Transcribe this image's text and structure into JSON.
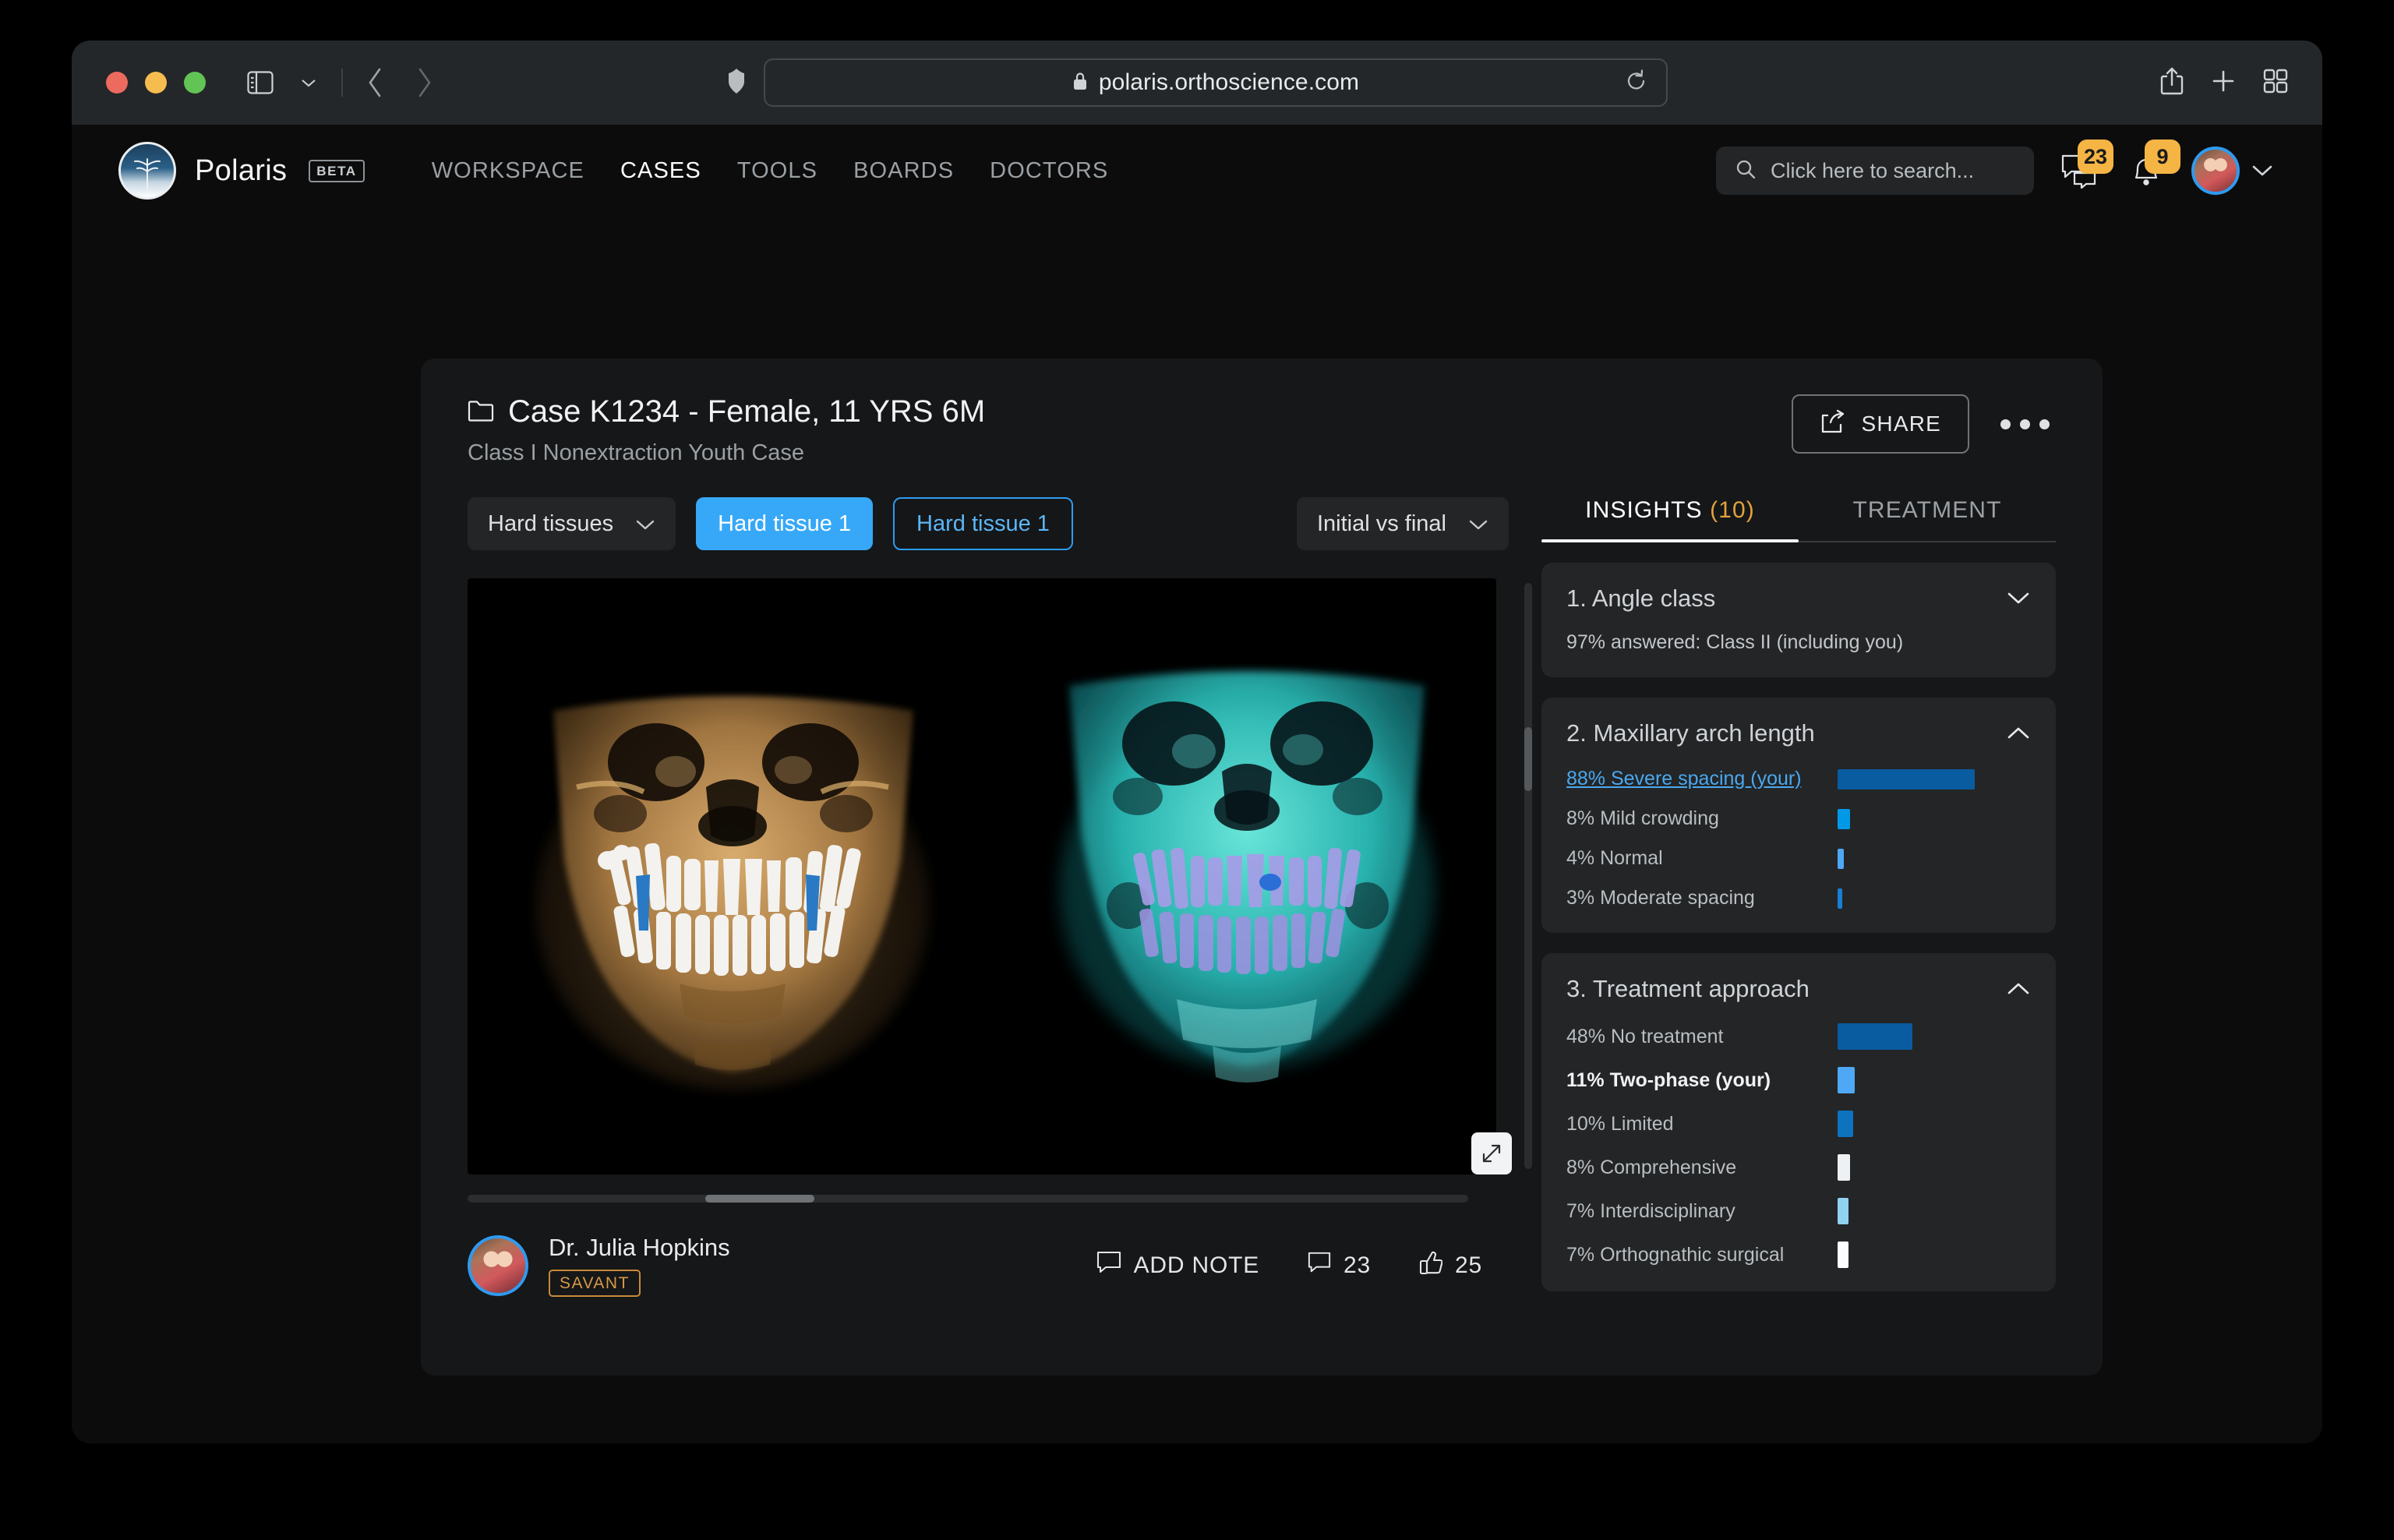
{
  "browser": {
    "url": "polaris.orthoscience.com",
    "lock_icon": "lock-icon",
    "shield_icon": "privacy-shield-icon",
    "reload_icon": "reload-icon",
    "sidebar_icon": "sidebar-toggle-icon",
    "back_icon": "back-arrow-icon",
    "forward_icon": "forward-arrow-icon",
    "share_icon": "share-icon",
    "new_tab_icon": "plus-icon",
    "tab_overview_icon": "tab-grid-icon"
  },
  "appbar": {
    "brand": "Polaris",
    "beta": "BETA",
    "logo_icon": "polaris-tree-logo",
    "nav": [
      {
        "label": "WORKSPACE",
        "active": false
      },
      {
        "label": "CASES",
        "active": true
      },
      {
        "label": "TOOLS",
        "active": false
      },
      {
        "label": "BOARDS",
        "active": false
      },
      {
        "label": "DOCTORS",
        "active": false
      }
    ],
    "search": {
      "placeholder": "Click here to search...",
      "icon": "search-icon",
      "value": ""
    },
    "messages": {
      "icon": "chat-bubble-icon",
      "count": "23"
    },
    "notifications": {
      "icon": "bell-icon",
      "count": "9"
    },
    "account": {
      "avatar_icon": "user-avatar",
      "chevron_icon": "chevron-down-icon"
    }
  },
  "case": {
    "folder_icon": "folder-icon",
    "title": "Case K1234 - Female, 11 YRS 6M",
    "subtitle": "Class I Nonextraction Youth Case",
    "share_label": "SHARE",
    "share_icon": "share-arrow-icon",
    "more_icon": "ellipsis-icon"
  },
  "controls": {
    "tissue_select": {
      "label": "Hard tissues",
      "chevron_icon": "chevron-down-icon"
    },
    "chip_filled": "Hard tissue 1",
    "chip_outline": "Hard tissue 1",
    "compare_select": {
      "label": "Initial vs final",
      "chevron_icon": "chevron-down-icon"
    }
  },
  "viewer": {
    "expand_icon": "expand-fullscreen-icon",
    "scan_left": "cbct-skull-amber",
    "scan_right": "cbct-skull-cyan",
    "h_scroll_icon": "horizontal-scrollbar",
    "v_scroll_icon": "vertical-scrollbar"
  },
  "footer": {
    "author_avatar_icon": "author-avatar",
    "author_name": "Dr. Julia Hopkins",
    "author_badge": "SAVANT",
    "add_note": {
      "label": "ADD NOTE",
      "icon": "note-bubble-icon"
    },
    "comments": {
      "count": "23",
      "icon": "comment-bubble-icon"
    },
    "likes": {
      "count": "25",
      "icon": "thumbs-up-icon"
    }
  },
  "insights": {
    "tabs": [
      {
        "label": "INSIGHTS",
        "count": "(10)",
        "active": true
      },
      {
        "label": "TREATMENT",
        "count": "",
        "active": false
      }
    ],
    "cards": [
      {
        "title": "1. Angle class",
        "chevron_icon": "chevron-down-icon",
        "expanded": false,
        "note": "97% answered: Class II (including you)"
      },
      {
        "title": "2. Maxillary arch length",
        "chevron_icon": "chevron-up-icon",
        "expanded": true,
        "rows": [
          {
            "label": "88% Severe spacing (your)",
            "value": 88,
            "style": "link",
            "color": "#0a5ca0"
          },
          {
            "label": "8% Mild crowding",
            "value": 8,
            "style": "normal",
            "color": "#0099e8"
          },
          {
            "label": "4% Normal",
            "value": 4,
            "style": "normal",
            "color": "#4fa8f5"
          },
          {
            "label": "3% Moderate spacing",
            "value": 3,
            "style": "normal",
            "color": "#1a7fd4"
          }
        ]
      },
      {
        "title": "3. Treatment approach",
        "chevron_icon": "chevron-up-icon",
        "expanded": true,
        "rows": [
          {
            "label": "48% No treatment",
            "value": 48,
            "style": "normal",
            "color": "#0a5ca0"
          },
          {
            "label": "11% Two-phase (your)",
            "value": 11,
            "style": "strong",
            "color": "#4fa8f5"
          },
          {
            "label": "10% Limited",
            "value": 10,
            "style": "normal",
            "color": "#0e73be"
          },
          {
            "label": "8% Comprehensive",
            "value": 8,
            "style": "normal",
            "color": "#eef1f3"
          },
          {
            "label": "7% Interdisciplinary",
            "value": 7,
            "style": "normal",
            "color": "#8fd2f2"
          },
          {
            "label": "7% Orthognathic surgical",
            "value": 7,
            "style": "normal",
            "color": "#fbfdff"
          }
        ]
      }
    ]
  },
  "chart_data": [
    {
      "type": "bar",
      "title": "2. Maxillary arch length",
      "orientation": "horizontal",
      "categories": [
        "Severe spacing (your)",
        "Mild crowding",
        "Normal",
        "Moderate spacing"
      ],
      "values": [
        88,
        8,
        4,
        3
      ],
      "unit": "%",
      "xlabel": "",
      "ylabel": "",
      "xlim": [
        0,
        100
      ],
      "grid": false,
      "legend": "none",
      "colors": [
        "#0a5ca0",
        "#0099e8",
        "#4fa8f5",
        "#1a7fd4"
      ],
      "highlight": "Severe spacing (your)"
    },
    {
      "type": "bar",
      "title": "3. Treatment approach",
      "orientation": "horizontal",
      "categories": [
        "No treatment",
        "Two-phase (your)",
        "Limited",
        "Comprehensive",
        "Interdisciplinary",
        "Orthognathic surgical"
      ],
      "values": [
        48,
        11,
        10,
        8,
        7,
        7
      ],
      "unit": "%",
      "xlabel": "",
      "ylabel": "",
      "xlim": [
        0,
        100
      ],
      "grid": false,
      "legend": "none",
      "colors": [
        "#0a5ca0",
        "#4fa8f5",
        "#0e73be",
        "#eef1f3",
        "#8fd2f2",
        "#fbfdff"
      ],
      "highlight": "Two-phase (your)"
    }
  ]
}
